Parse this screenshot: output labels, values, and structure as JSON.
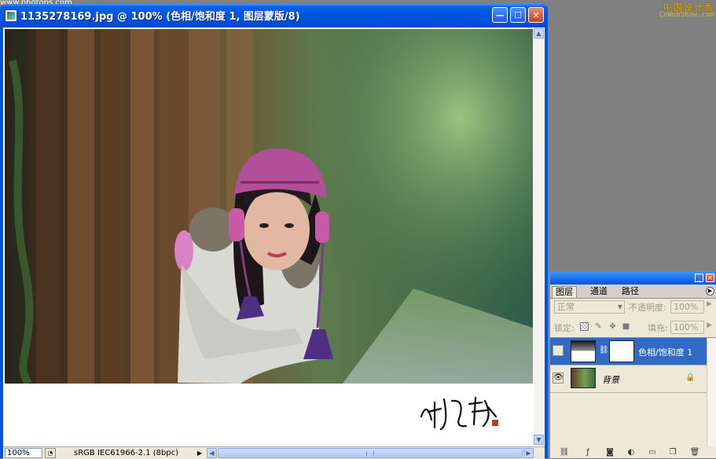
{
  "watermark": {
    "top_left": "www.photops.com",
    "logo_chinese": "中国设计秀",
    "logo_latin": "CnWebShow.com"
  },
  "document": {
    "title": "1135278169.jpg @ 100% (色相/饱和度 1, 图层蒙版/8)",
    "min_glyph": "—",
    "max_glyph": "☐",
    "close_glyph": "✕",
    "status": {
      "zoom": "100%",
      "profile": "sRGB IEC61966-2.1 (8bpc)"
    }
  },
  "layers_panel": {
    "tabs": [
      "图层",
      "通道",
      "路径"
    ],
    "blend_mode": "正常",
    "opacity_label": "不透明度:",
    "opacity_value": "100%",
    "lock_label": "锁定:",
    "fill_label": "填充:",
    "fill_value": "100%",
    "layers": [
      {
        "name": "色相/饱和度 1",
        "selected": true,
        "visible": false,
        "type": "adjustment"
      },
      {
        "name": "背景",
        "selected": false,
        "visible": true,
        "locked": true
      }
    ]
  },
  "colors": {
    "titlebar": "#0054e3",
    "selection": "#316ac5",
    "panel": "#ece9d8",
    "workspace": "#808080"
  }
}
